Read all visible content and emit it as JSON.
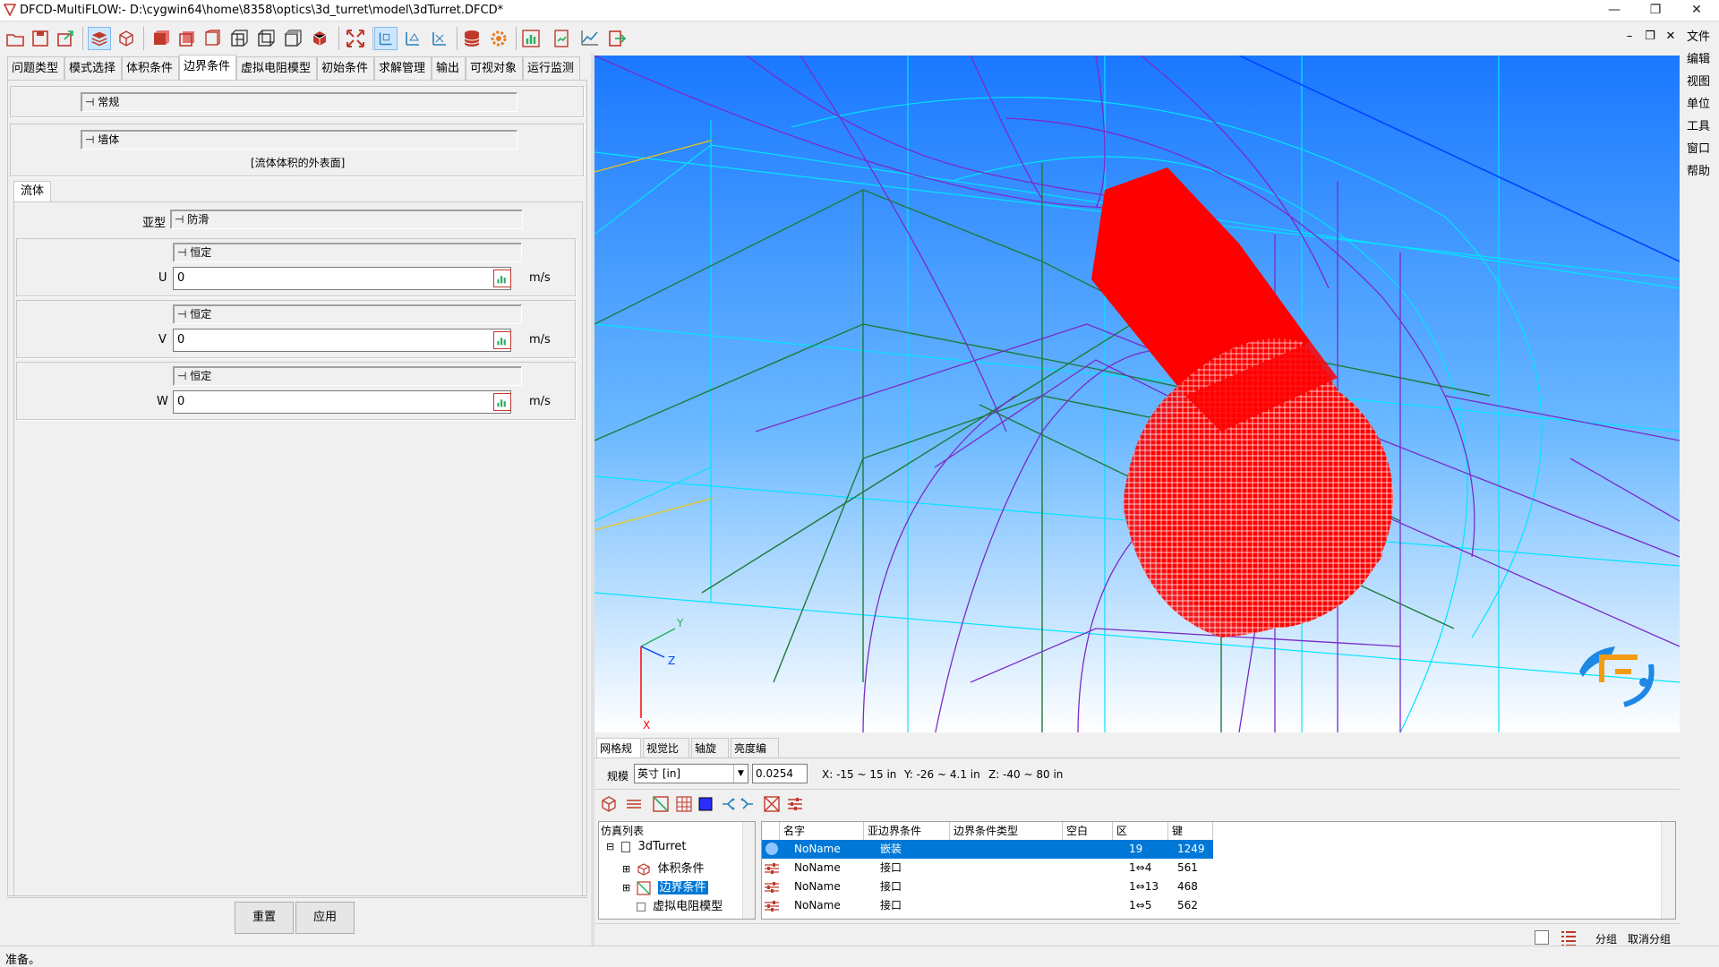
{
  "window": {
    "title": "DFCD-MultiFLOW:- D:\\cygwin64\\home\\8358\\optics\\3d_turret\\model\\3dTurret.DFCD*",
    "minimize": "—",
    "restore": "❐",
    "close": "✕"
  },
  "mdi": {
    "minimize": "–",
    "restore": "❐",
    "close": "✕"
  },
  "right_menu": [
    "文件",
    "编辑",
    "视图",
    "单位",
    "工具",
    "窗口",
    "帮助"
  ],
  "tabs": [
    "问题类型",
    "模式选择",
    "体积条件",
    "边界条件",
    "虚拟电阻模型",
    "初始条件",
    "求解管理",
    "输出",
    "可视对象",
    "运行监测"
  ],
  "active_tab": "边界条件",
  "panel": {
    "general": "⊣ 常规",
    "wall": "⊣ 墙体",
    "wall_desc": "[流体体积的外表面]",
    "fluid_tab": "流体",
    "subtype_label": "亚型",
    "subtype_value": "⊣ 防滑",
    "velocity": [
      {
        "mode": "⊣ 恒定",
        "label": "U",
        "value": "0",
        "unit": "m/s"
      },
      {
        "mode": "⊣ 恒定",
        "label": "V",
        "value": "0",
        "unit": "m/s"
      },
      {
        "mode": "⊣ 恒定",
        "label": "W",
        "value": "0",
        "unit": "m/s"
      }
    ],
    "reset": "重置",
    "apply": "应用"
  },
  "axes": {
    "y": "Y",
    "z": "Z",
    "x": "X"
  },
  "bottom_tabs": [
    "网格规模",
    "视觉比例",
    "轴旋转",
    "亮度编辑"
  ],
  "scale": {
    "label": "规模",
    "unit_select": "英寸 [in]",
    "factor": "0.0254",
    "x_range": "X: -15 ~ 15 in",
    "y_range": "Y: -26 ~ 4.1 in",
    "z_range": "Z: -40 ~ 80 in"
  },
  "tree": {
    "header": "仿真列表",
    "items": [
      {
        "label": "3dTurret",
        "toggle": "⊟"
      },
      {
        "label": "体积条件",
        "toggle": "⊞"
      },
      {
        "label": "边界条件",
        "toggle": "⊞"
      },
      {
        "label": "虚拟电阻模型",
        "toggle": ""
      }
    ]
  },
  "grid": {
    "headers": [
      "名字",
      "亚边界条件",
      "边界条件类型",
      "空白",
      "区",
      "键"
    ],
    "rows": [
      {
        "name": "NoName",
        "sub": "嵌装",
        "type": "",
        "blank": "",
        "zone": "19",
        "key": "1249",
        "selected": true
      },
      {
        "name": "NoName",
        "sub": "接口",
        "type": "",
        "blank": "",
        "zone": "1⇔4",
        "key": "561",
        "selected": false
      },
      {
        "name": "NoName",
        "sub": "接口",
        "type": "",
        "blank": "",
        "zone": "1⇔13",
        "key": "468",
        "selected": false
      },
      {
        "name": "NoName",
        "sub": "接口",
        "type": "",
        "blank": "",
        "zone": "1⇔5",
        "key": "562",
        "selected": false
      }
    ]
  },
  "grouping": {
    "group": "分组",
    "ungroup": "取消分组"
  },
  "status": "准备。",
  "colors": {
    "accent": "#0078d7",
    "mesh_red": "#ff0000",
    "viewport_top": "#1a78ff",
    "viewport_bottom": "#ffffff"
  }
}
